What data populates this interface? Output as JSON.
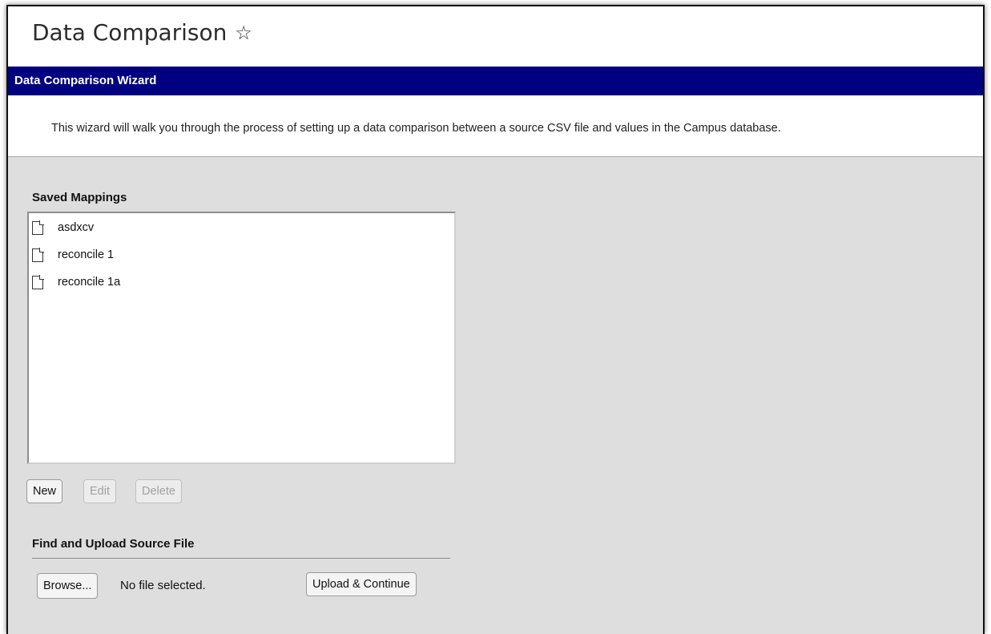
{
  "page": {
    "title": "Data Comparison"
  },
  "wizard": {
    "header": "Data Comparison Wizard",
    "intro": "This wizard will walk you through the process of setting up a data comparison between a source CSV file and values in the Campus database."
  },
  "mappings": {
    "label": "Saved Mappings",
    "items": [
      {
        "label": "asdxcv"
      },
      {
        "label": "reconcile 1"
      },
      {
        "label": "reconcile 1a"
      }
    ],
    "buttons": {
      "new": "New",
      "edit": "Edit",
      "delete": "Delete"
    }
  },
  "upload": {
    "label": "Find and Upload Source File",
    "browse": "Browse...",
    "file_status": "No file selected.",
    "submit": "Upload & Continue"
  },
  "colors": {
    "wizard_bar": "#000080",
    "panel_background": "#dedede"
  }
}
